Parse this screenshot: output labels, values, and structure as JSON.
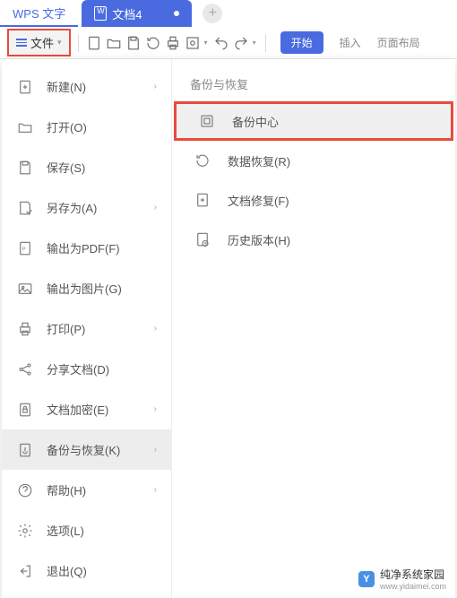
{
  "tabs": {
    "wps_label": "WPS 文字",
    "doc_label": "文档4"
  },
  "toolbar": {
    "file_label": "文件"
  },
  "ribbon": {
    "start": "开始",
    "insert": "插入",
    "page_layout": "页面布局"
  },
  "file_menu": {
    "new": "新建(N)",
    "open": "打开(O)",
    "save": "保存(S)",
    "save_as": "另存为(A)",
    "export_pdf": "输出为PDF(F)",
    "export_image": "输出为图片(G)",
    "print": "打印(P)",
    "share": "分享文档(D)",
    "encrypt": "文档加密(E)",
    "backup": "备份与恢复(K)",
    "help": "帮助(H)",
    "options": "选项(L)",
    "exit": "退出(Q)"
  },
  "backup_submenu": {
    "title": "备份与恢复",
    "backup_center": "备份中心",
    "data_recovery": "数据恢复(R)",
    "doc_repair": "文档修复(F)",
    "history": "历史版本(H)"
  },
  "watermark": {
    "text": "纯净系统家园",
    "url": "www.yidaimei.com"
  }
}
